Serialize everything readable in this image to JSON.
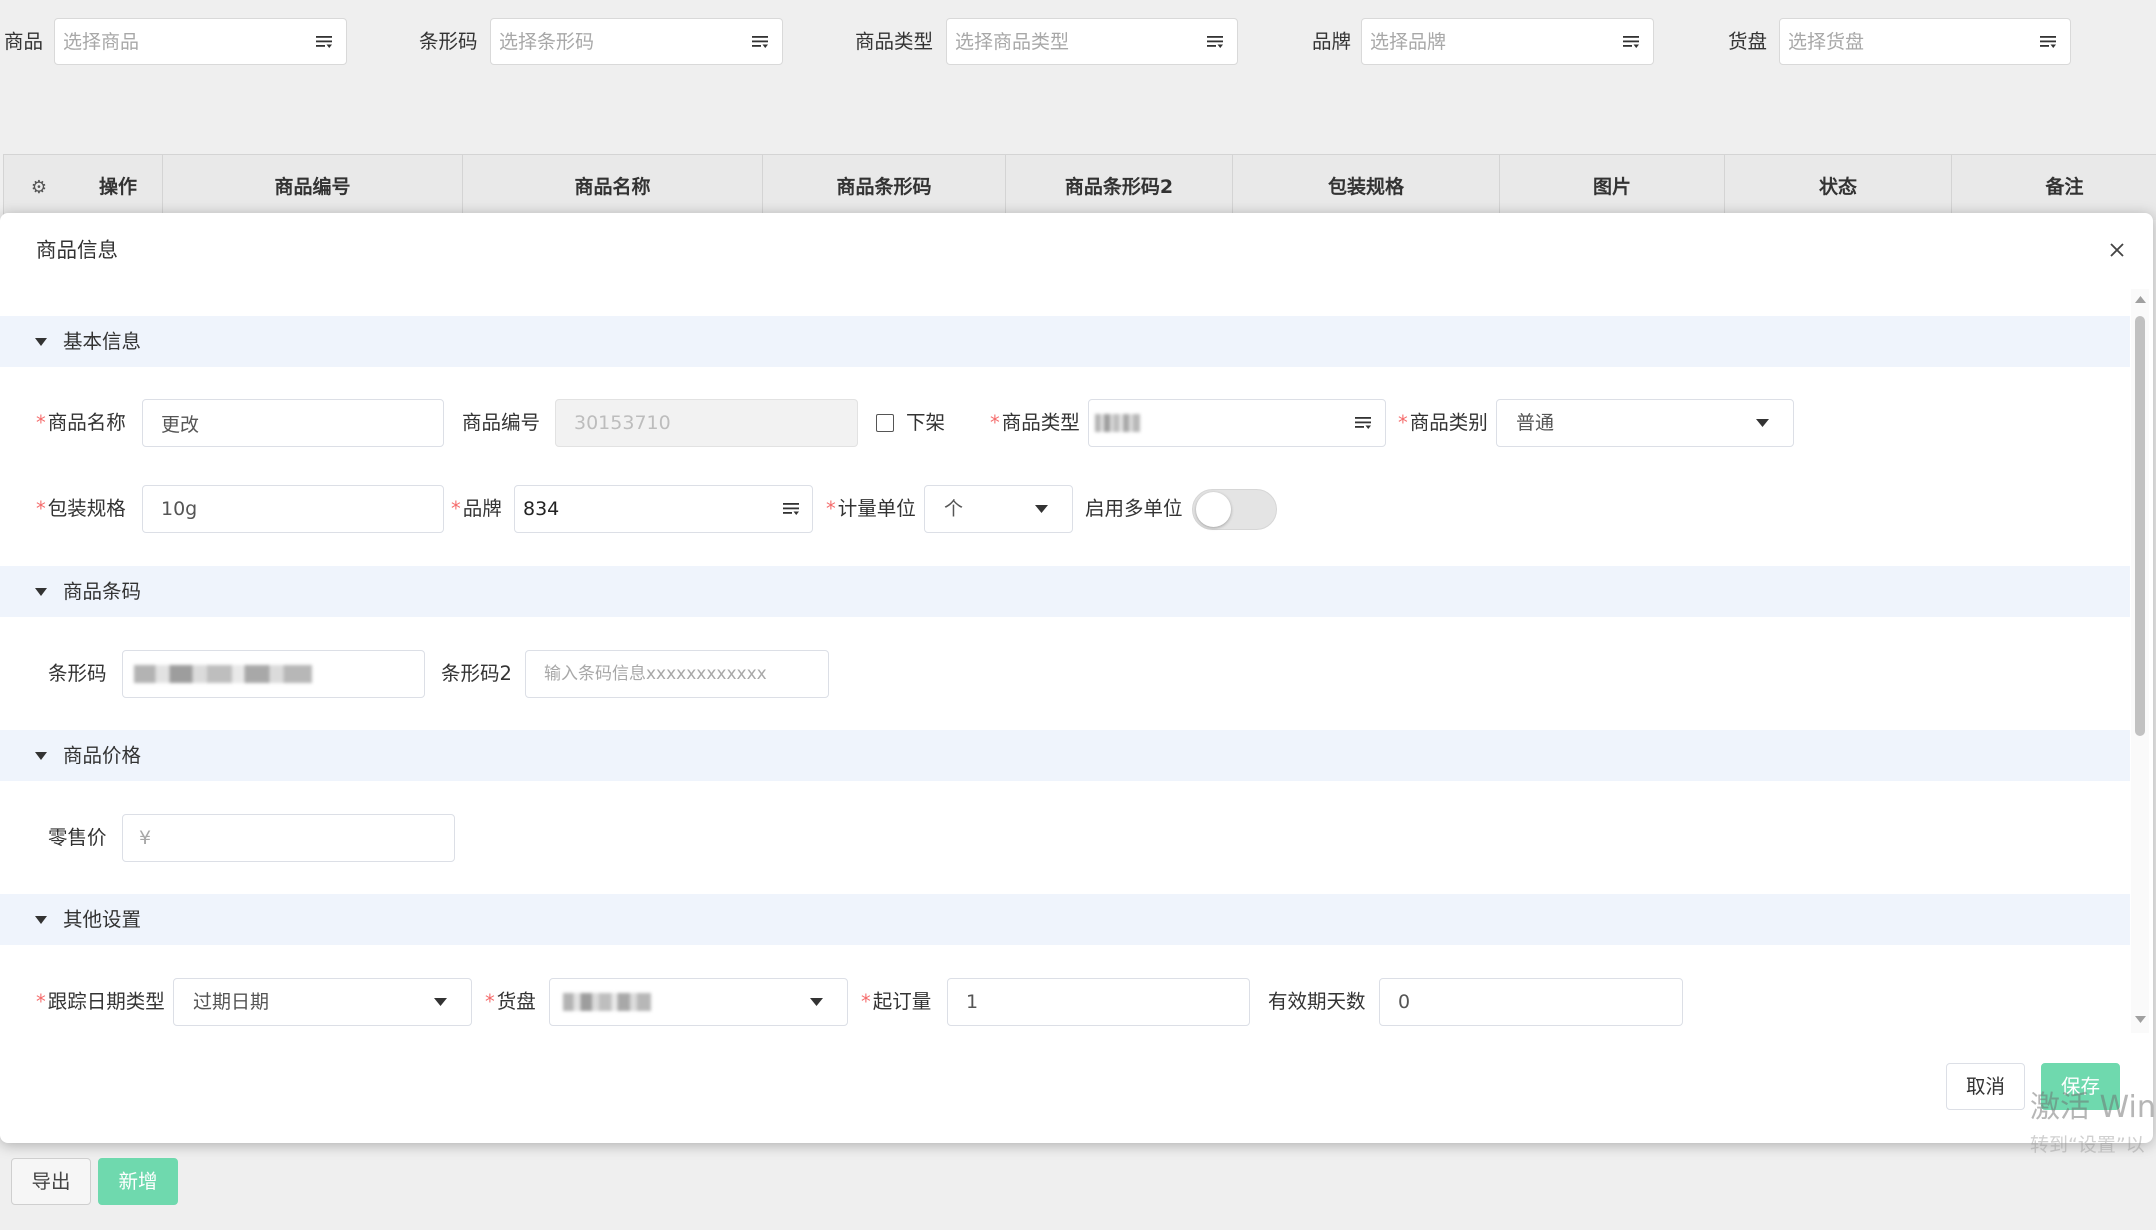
{
  "filters": [
    {
      "label": "商品",
      "placeholder": "选择商品"
    },
    {
      "label": "条形码",
      "placeholder": "选择条形码"
    },
    {
      "label": "商品类型",
      "placeholder": "选择商品类型"
    },
    {
      "label": "品牌",
      "placeholder": "选择品牌"
    },
    {
      "label": "货盘",
      "placeholder": "选择货盘"
    }
  ],
  "table": {
    "settings_icon": "gear-icon",
    "columns": [
      "操作",
      "商品编号",
      "商品名称",
      "商品条形码",
      "商品条形码2",
      "包装规格",
      "图片",
      "状态",
      "备注"
    ]
  },
  "modal": {
    "title": "商品信息",
    "close_icon": "close-icon",
    "required_mark": "*",
    "sections": {
      "basic": "基本信息",
      "barcode": "商品条码",
      "price": "商品价格",
      "other": "其他设置"
    },
    "basic": {
      "name": {
        "label": "商品名称",
        "value": "更改"
      },
      "code": {
        "label": "商品编号",
        "value": "30153710"
      },
      "off_shelf": {
        "label": "下架",
        "checked": false
      },
      "type": {
        "label": "商品类型"
      },
      "category": {
        "label": "商品类别",
        "value": "普通"
      },
      "package": {
        "label": "包装规格",
        "value": "10g"
      },
      "brand": {
        "label": "品牌",
        "value": "834"
      },
      "unit": {
        "label": "计量单位",
        "value": "个"
      },
      "multi_unit": {
        "label": "启用多单位",
        "enabled": false
      }
    },
    "barcode": {
      "barcode": {
        "label": "条形码"
      },
      "barcode2": {
        "label": "条形码2",
        "placeholder": "输入条码信息xxxxxxxxxxxx"
      }
    },
    "price": {
      "retail": {
        "label": "零售价",
        "placeholder": "¥"
      }
    },
    "other": {
      "date_type": {
        "label": "跟踪日期类型",
        "value": "过期日期"
      },
      "pallet": {
        "label": "货盘"
      },
      "moq": {
        "label": "起订量",
        "value": "1"
      },
      "shelf_days": {
        "label": "有效期天数",
        "value": "0"
      }
    },
    "footer": {
      "cancel": "取消",
      "save": "保存"
    }
  },
  "page_actions": {
    "export": "导出",
    "add": "新增"
  },
  "watermark": {
    "line1": "激活 Win",
    "line2": "转到“设置”以"
  },
  "colors": {
    "page_bg": "#efefef",
    "accent": "#6fd9ae",
    "required": "#f56c6c",
    "section_bg": "#eff4fc"
  }
}
